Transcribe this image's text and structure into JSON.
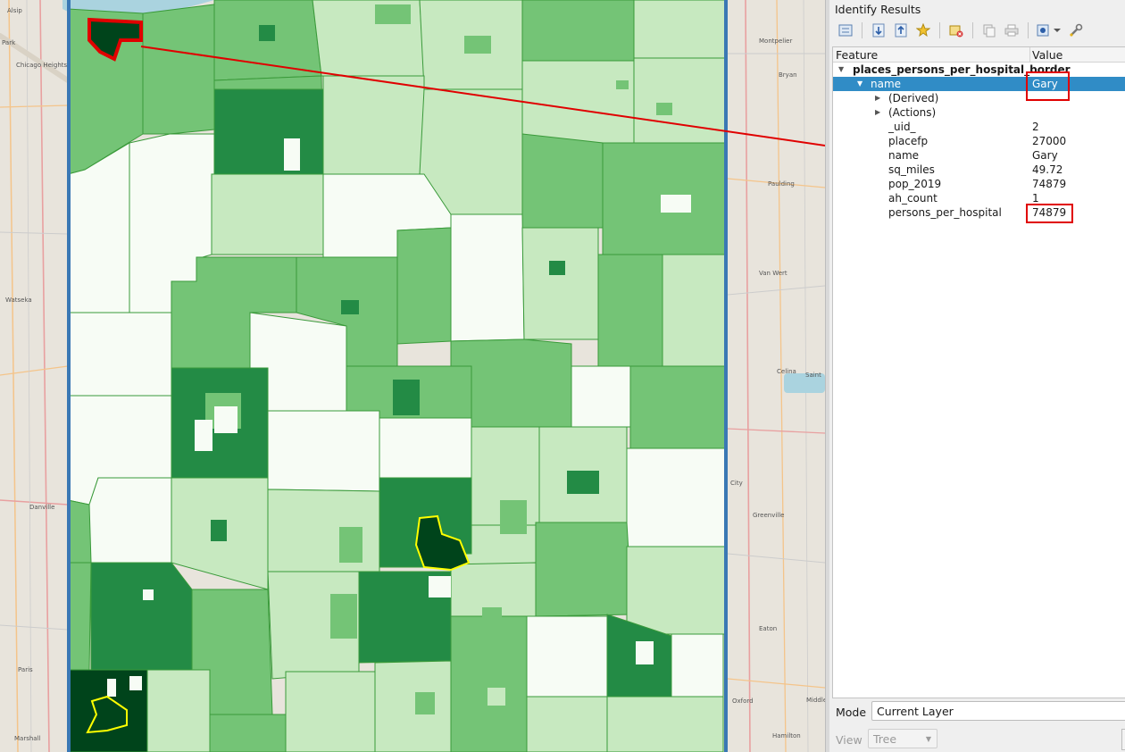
{
  "colors": {
    "class1": "#f7fcf5",
    "class2": "#c7e9c0",
    "class3": "#74c476",
    "class4": "#238b45",
    "class5": "#00441b",
    "border": "#2a8a2a",
    "state_line": "#3a78b4",
    "highlight_red": "#e00000",
    "highlight_yellow": "#ffff00",
    "water": "#aad3df",
    "selected_row": "#308cc6"
  },
  "map": {
    "city_labels": [
      "Alsip",
      "Park",
      "Chicago Heights",
      "Watseka",
      "Danville",
      "Paris",
      "Marshall",
      "Montpelier",
      "Bryan",
      "Paulding",
      "Van Wert",
      "Celina",
      "Saint",
      "City",
      "Greenville",
      "Eaton",
      "Oxford",
      "Middle",
      "Hamilton"
    ]
  },
  "panel": {
    "title": "Identify Results",
    "columns": {
      "feature": "Feature",
      "value": "Value"
    },
    "layer": "places_persons_per_hospital_border",
    "selected": {
      "feature": "name",
      "value": "Gary"
    },
    "groups": [
      "(Derived)",
      "(Actions)"
    ],
    "attributes": [
      {
        "feature": "_uid_",
        "value": "2"
      },
      {
        "feature": "placefp",
        "value": "27000"
      },
      {
        "feature": "name",
        "value": "Gary"
      },
      {
        "feature": "sq_miles",
        "value": "49.72"
      },
      {
        "feature": "pop_2019",
        "value": "74879"
      },
      {
        "feature": "ah_count",
        "value": "1"
      },
      {
        "feature": "persons_per_hospital",
        "value": "74879"
      }
    ],
    "mode_label": "Mode",
    "mode_value": "Current Layer",
    "view_label": "View",
    "view_value": "Tree"
  }
}
